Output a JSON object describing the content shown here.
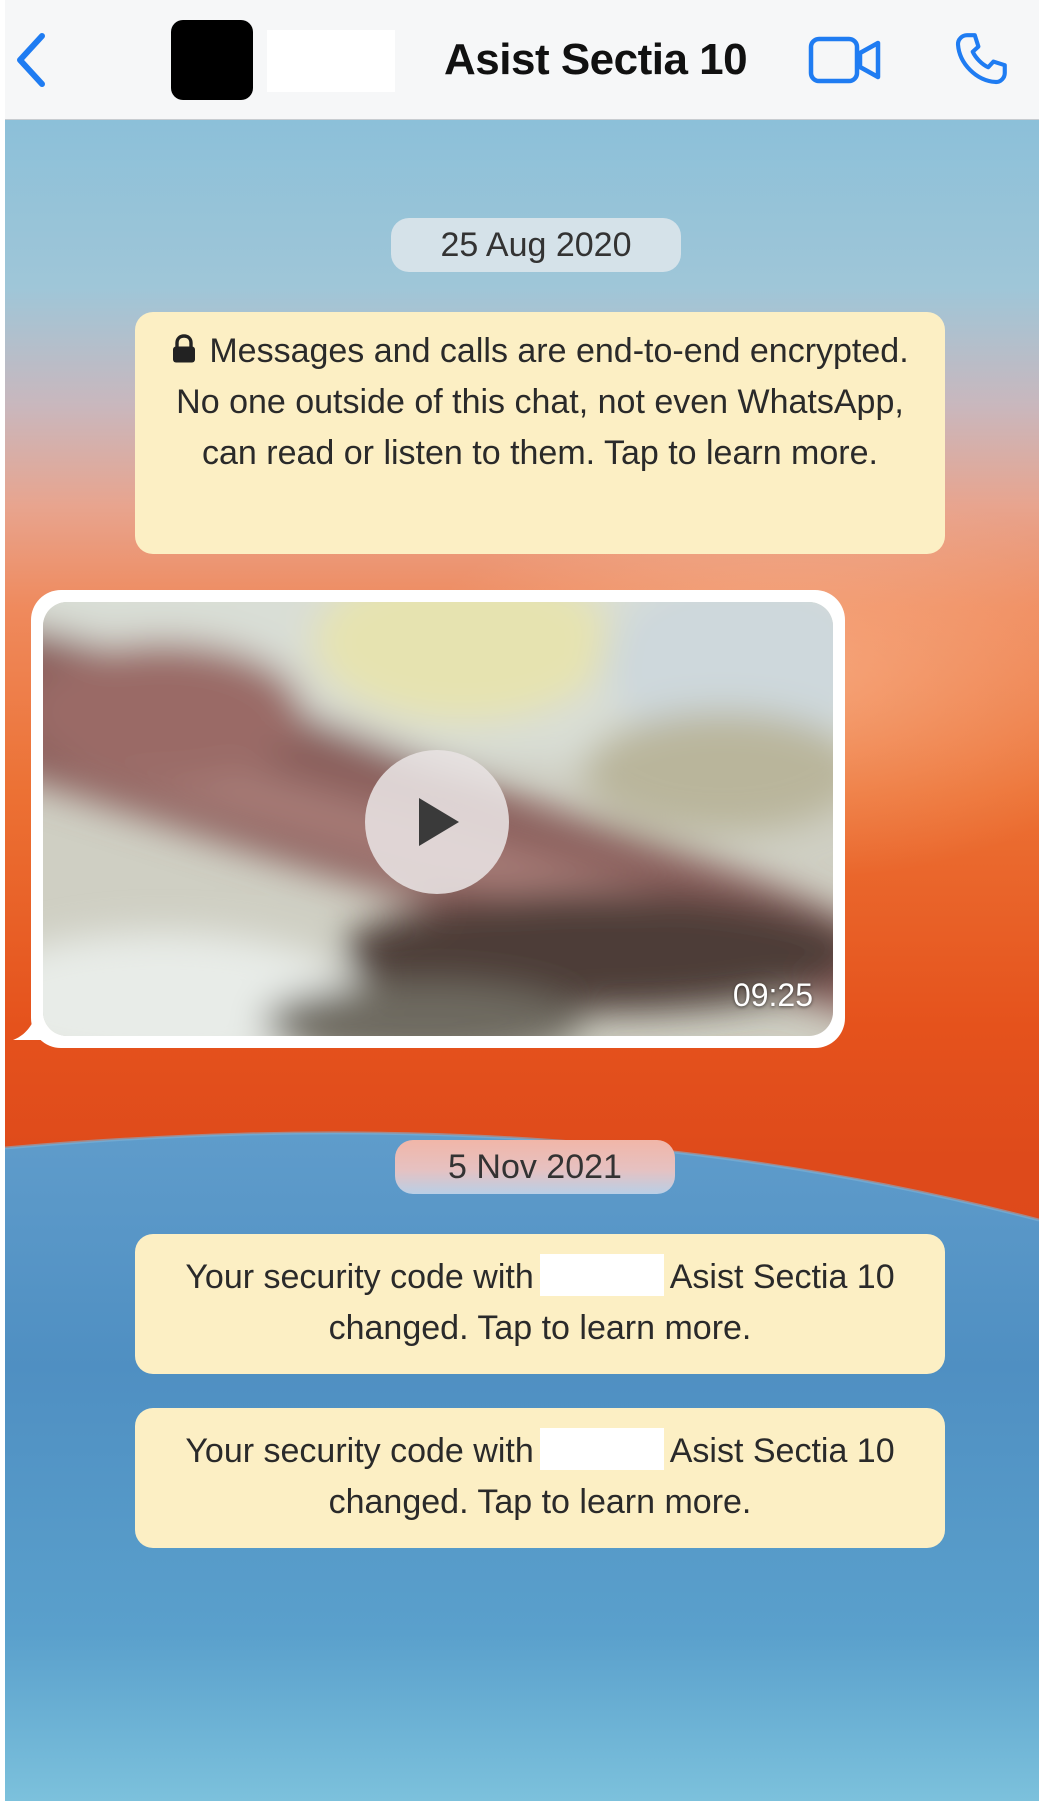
{
  "header": {
    "contact_name": "Asist Sectia 10",
    "back_icon": "chevron-left-icon",
    "video_icon": "video-camera-icon",
    "call_icon": "phone-icon"
  },
  "chat": {
    "date_1": "25 Aug 2020",
    "encryption_notice": "Messages and calls are end-to-end encrypted. No one outside of this chat, not even WhatsApp, can read or listen to them. Tap to learn more.",
    "video_message": {
      "duration": "09:25",
      "play_icon": "play-icon"
    },
    "date_2": "5 Nov 2021",
    "security_notices": [
      {
        "prefix": "Your security code with",
        "suffix": "Asist Sectia 10 changed. Tap to learn more."
      },
      {
        "prefix": "Your security code with",
        "suffix": "Asist Sectia 10 changed. Tap to learn more."
      }
    ]
  },
  "colors": {
    "ios_blue": "#1f7cf2",
    "system_bubble": "#fcefc4",
    "header_bg": "#f6f7f8"
  }
}
